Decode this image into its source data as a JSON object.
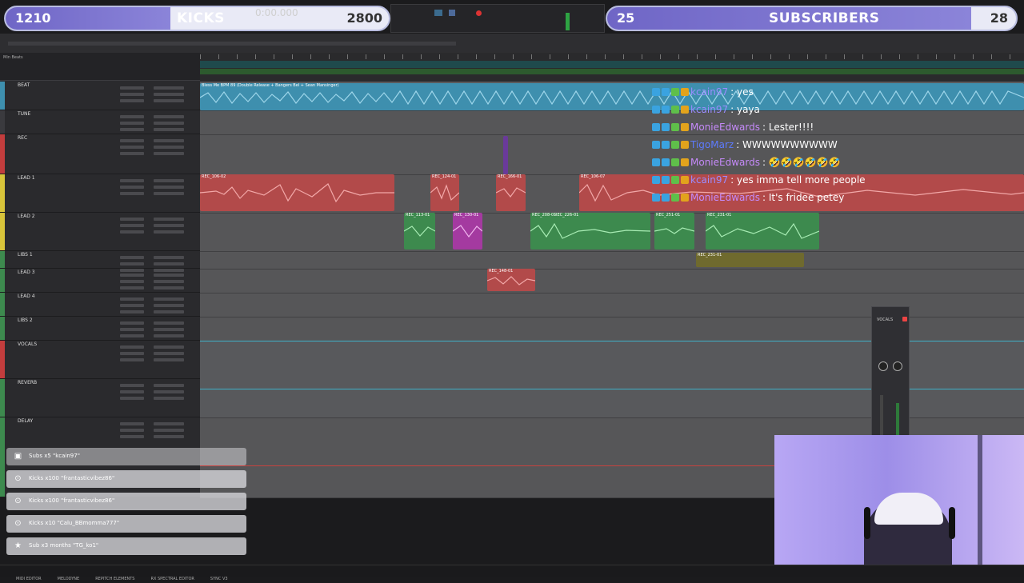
{
  "goals": {
    "left": {
      "current": "1210",
      "title": "KICKS",
      "target": "2800",
      "fill_fraction": 0.43
    },
    "right": {
      "current": "25",
      "title": "SUBSCRIBERS",
      "target": "28",
      "fill_fraction": 0.89
    }
  },
  "transport": {
    "counter": "0:00.000"
  },
  "tracks": [
    {
      "name": "BEAT",
      "color": "#3e8fae"
    },
    {
      "name": "TUNE",
      "color": "#3a3a3e"
    },
    {
      "name": "REC",
      "color": "#c23d3d"
    },
    {
      "name": "LEAD 1",
      "color": "#d8c43a"
    },
    {
      "name": "LEAD 2",
      "color": "#d8c43a"
    },
    {
      "name": "LIBS 1",
      "color": "#3d8a4e"
    },
    {
      "name": "LEAD 3",
      "color": "#3d8a4e"
    },
    {
      "name": "LEAD 4",
      "color": "#3d8a4e"
    },
    {
      "name": "LIBS 2",
      "color": "#3d8a4e"
    },
    {
      "name": "VOCALS",
      "color": "#c23d3d"
    },
    {
      "name": "REVERB",
      "color": "#3d8a4e"
    },
    {
      "name": "DELAY",
      "color": "#3d8a4e"
    }
  ],
  "clips": {
    "beat_label": "Bless Me BPM 89 (Double Release + Bangers Bel + Sean Mansinger)",
    "rec_1": "REC_106-02",
    "rec_2": "REC_124-01",
    "rec_3": "REC_166-01",
    "rec_4": "REC_106-07",
    "lead2_1": "REC_113-01",
    "lead2_2": "REC_130-01",
    "lead2_3": "REC_208-01",
    "lead2_4": "REC_226-01",
    "lead2_5": "REC_251-01",
    "lead2_6": "REC_231-01",
    "libs_1": "REC_148-01"
  },
  "chat": [
    {
      "user": "kcain97",
      "text": ": yes",
      "color": "#9b8cff"
    },
    {
      "user": "kcain97",
      "text": ": yaya",
      "color": "#9b8cff"
    },
    {
      "user": "MonieEdwards",
      "text": ": Lester!!!!",
      "color": "#c58af9"
    },
    {
      "user": "TigoMarz",
      "text": ": WWWWWWWWWW",
      "color": "#5d7bff"
    },
    {
      "user": "MonieEdwards",
      "text": ": 🤣🤣🤣🤣🤣🤣",
      "color": "#c58af9"
    },
    {
      "user": "kcain97",
      "text": ": yes imma tell more people",
      "color": "#9b8cff"
    },
    {
      "user": "MonieEdwards",
      "text": ": It's fridee petey",
      "color": "#c58af9"
    }
  ],
  "alerts": [
    {
      "icon": "gift-icon",
      "text": "Subs x5 \"kcain97\""
    },
    {
      "icon": "kick-icon",
      "text": "Kicks x100 \"frantasticvibez86\""
    },
    {
      "icon": "kick-icon",
      "text": "Kicks x100 \"frantasticvibez86\""
    },
    {
      "icon": "kick-icon",
      "text": "Kicks x10 \"Calu_BBmomma777\""
    },
    {
      "icon": "star-icon",
      "text": "Sub x3 months \"TG_ko1\""
    }
  ],
  "plugin": {
    "label": "VOCALS"
  },
  "bottom_bar": [
    "MIDI EDITOR",
    "MELODYNE",
    "REPITCH ELEMENTS",
    "RX SPECTRAL EDITOR",
    "SYNC V3"
  ]
}
